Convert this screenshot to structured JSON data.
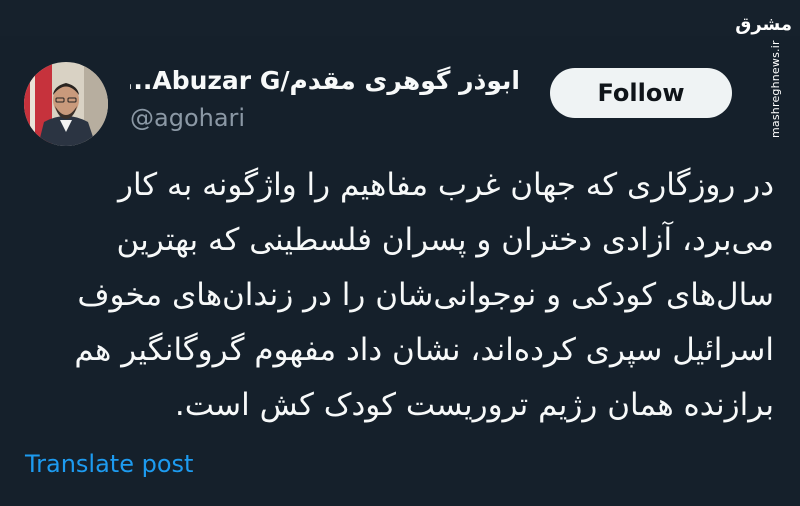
{
  "tweet": {
    "display_name": "ابوذر گوهری مقدم/Abuzar G...",
    "handle": "@agohari",
    "follow_label": "Follow",
    "text_lines": [
      "در روزگاری که جهان غرب مفاهیم را واژگونه به کار",
      "می‌برد، آزادی دختران و پسران فلسطینی که بهترین",
      "سال‌های کودکی و نوجوانی‌شان را در زندان‌های  مخوف",
      "اسرائیل سپری کرده‌اند، نشان داد مفهوم گروگانگیر هم",
      "برازنده همان رژیم تروریست کودک کش است."
    ],
    "translate_label": "Translate post"
  },
  "watermark": {
    "logo_text": "مشرق",
    "site": "mashreghnews.ir"
  },
  "colors": {
    "background": "#15202b",
    "text": "#f7f9f9",
    "secondary": "#8b98a5",
    "link": "#1d9bf0",
    "button_bg": "#eff3f4"
  }
}
